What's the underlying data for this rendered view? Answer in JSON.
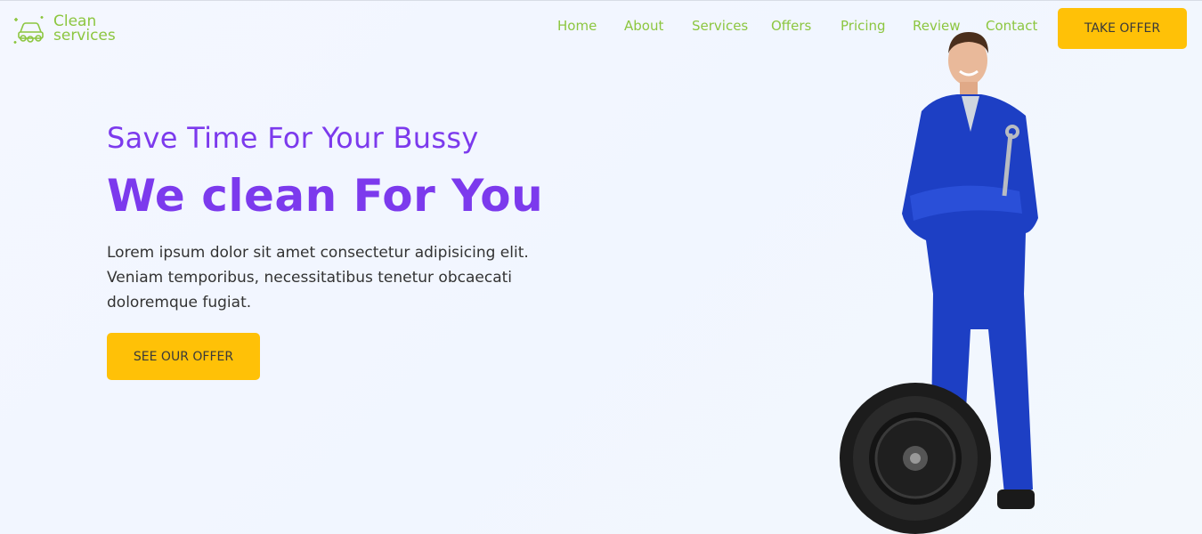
{
  "brand": {
    "line1": "Clean",
    "line2": "services",
    "icon": "car-wash-icon",
    "color": "#8cc63f"
  },
  "nav": {
    "items": [
      "Home",
      "About",
      "Services",
      "Offers",
      "Pricing",
      "Review",
      "Contact"
    ],
    "cta": "TAKE OFFER"
  },
  "hero": {
    "subtitle": "Save Time For Your Bussy",
    "title": "We clean For You",
    "description": "Lorem ipsum dolor sit amet consectetur adipisicing elit. Veniam temporibus, necessitatibus tenetur obcaecati doloremque fugiat.",
    "cta": "SEE OUR OFFER"
  },
  "colors": {
    "accent": "#7c3aed",
    "button": "#ffc107",
    "nav": "#8cc63f"
  }
}
